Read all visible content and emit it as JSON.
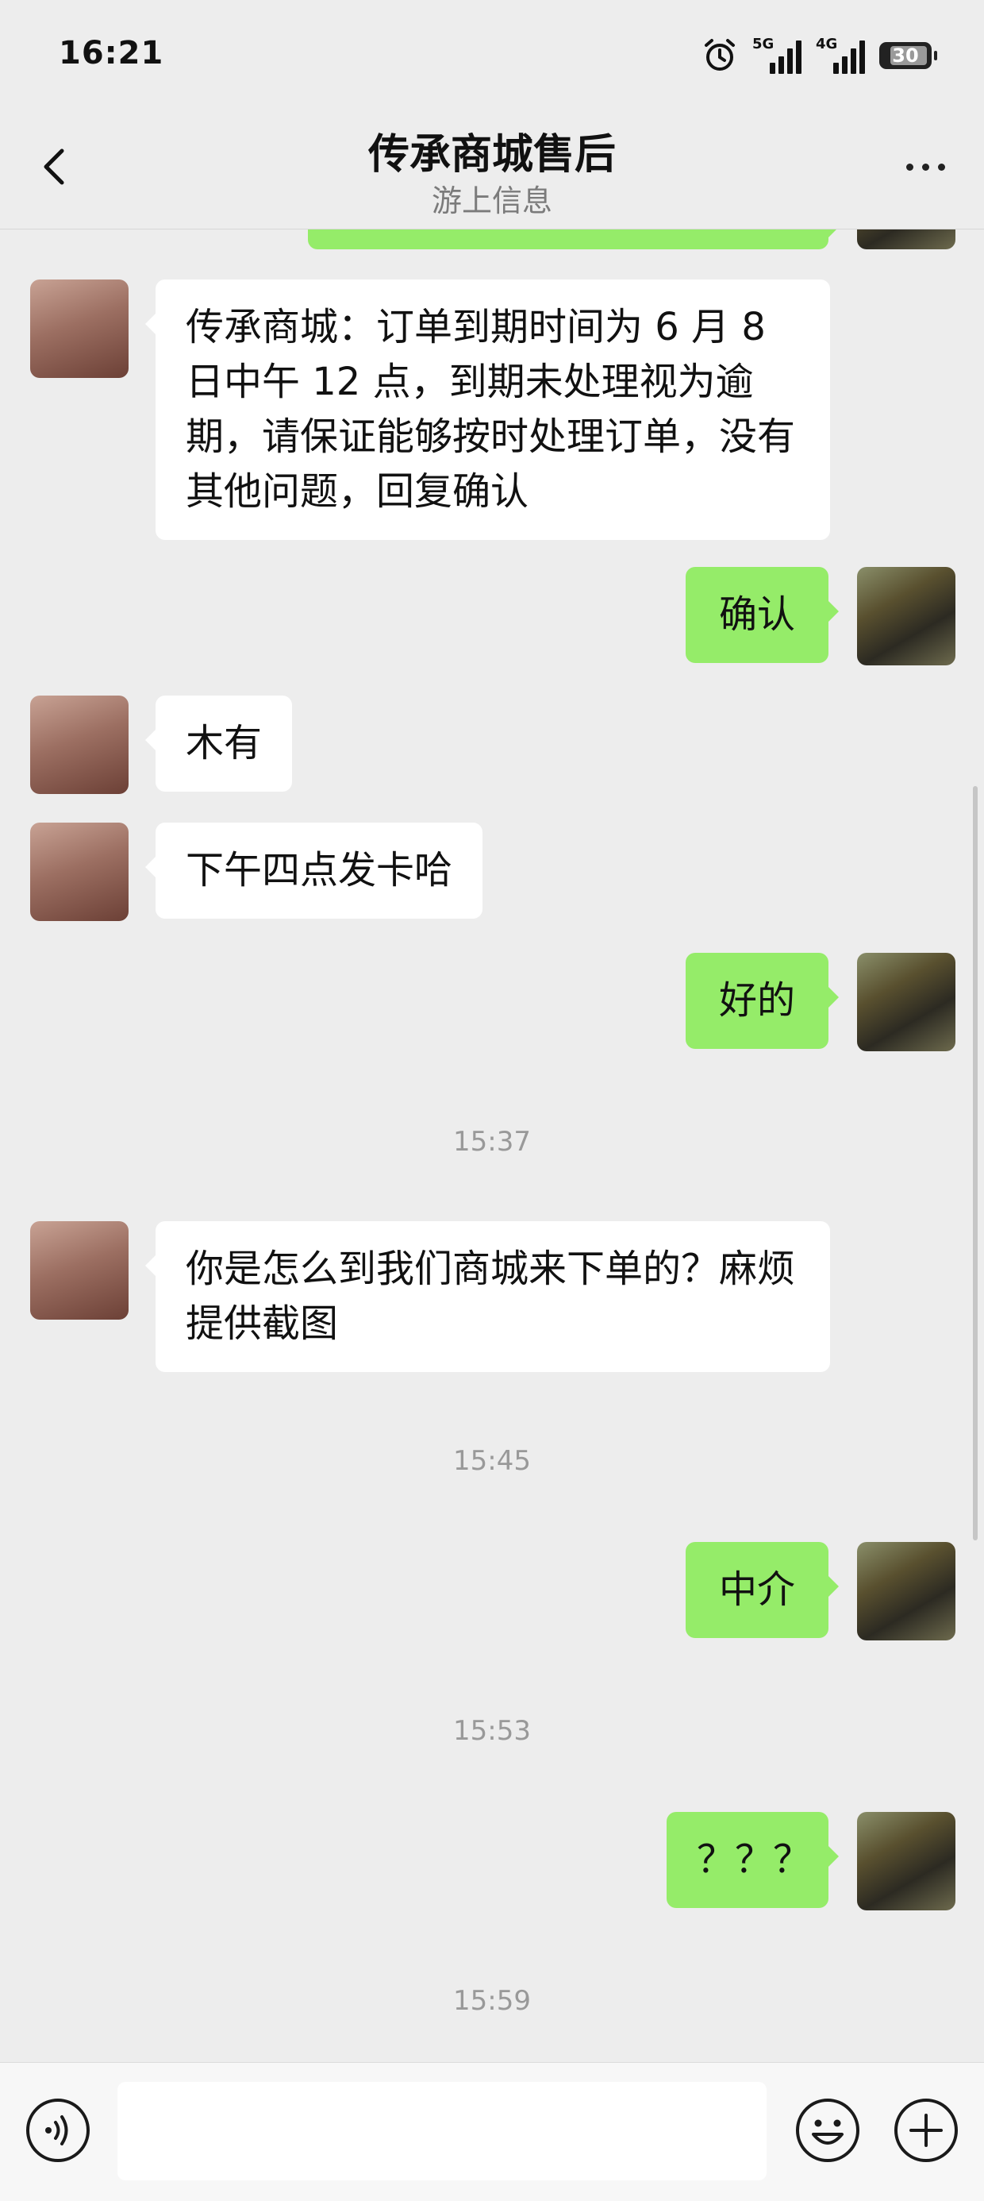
{
  "status_bar": {
    "time": "16:21",
    "signal1_label": "5G",
    "signal2_label": "4G",
    "battery": "30"
  },
  "header": {
    "title": "传承商城售后",
    "subtitle": "游上信息"
  },
  "messages": [
    {
      "side": "left",
      "text": "传承商城：订单到期时间为 6 月 8 日中午 12 点，到期未处理视为逾期，请保证能够按时处理订单，没有其他问题，回复确认"
    },
    {
      "side": "right",
      "text": "确认"
    },
    {
      "side": "left",
      "text": "木有"
    },
    {
      "side": "left",
      "text": "下午四点发卡哈"
    },
    {
      "side": "right",
      "text": "好的"
    },
    {
      "side": "left",
      "text": "你是怎么到我们商城来下单的？麻烦提供截图"
    },
    {
      "side": "right",
      "text": "中介"
    },
    {
      "side": "right",
      "text": "？？？"
    }
  ],
  "timestamps": [
    "15:37",
    "15:45",
    "15:53",
    "15:59"
  ],
  "colors": {
    "background": "#ededed",
    "bubble_self": "#95ec69",
    "bubble_other": "#ffffff"
  },
  "icons": [
    "back-icon",
    "more-icon",
    "voice-icon",
    "emoji-icon",
    "plus-icon",
    "alarm-icon"
  ]
}
